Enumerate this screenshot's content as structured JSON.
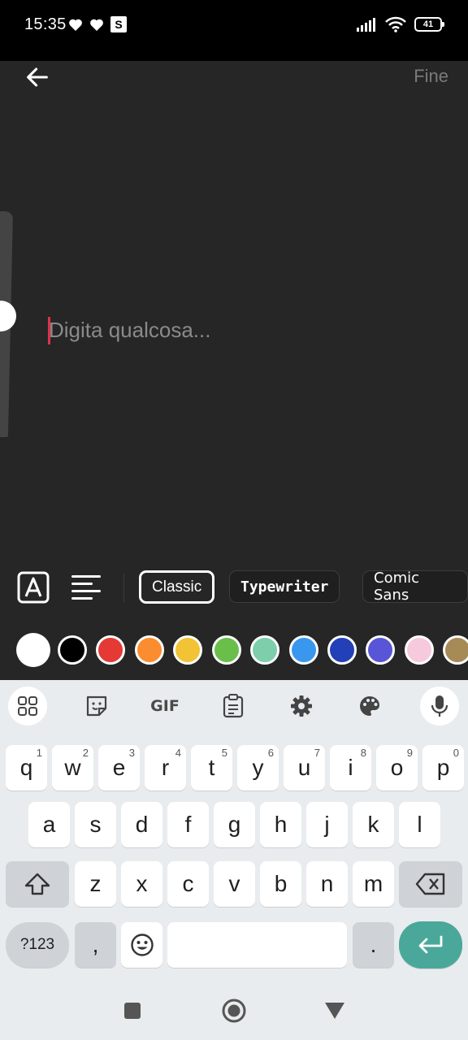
{
  "status_bar": {
    "time": "15:35",
    "battery": "41",
    "badge": "S"
  },
  "editor": {
    "done_label": "Fine",
    "placeholder": "Digita qualcosa..."
  },
  "fonts": [
    {
      "label": "Classic",
      "selected": true
    },
    {
      "label": "Typewriter",
      "selected": false
    },
    {
      "label": "Comic Sans",
      "selected": false
    }
  ],
  "colors": [
    "#ffffff",
    "#000000",
    "#e53935",
    "#fb8c2f",
    "#f2c335",
    "#6abf4b",
    "#7ccfaa",
    "#3a97ee",
    "#2340b8",
    "#5856d6",
    "#f6c9dd",
    "#a68b57"
  ],
  "keyboard": {
    "top_icons": [
      "apps-grid-icon",
      "sticker-icon",
      "GIF",
      "clipboard-icon",
      "gear-icon",
      "palette-icon",
      "mic-icon"
    ],
    "gif_label": "GIF",
    "row1": [
      "q",
      "w",
      "e",
      "r",
      "t",
      "y",
      "u",
      "i",
      "o",
      "p"
    ],
    "row1_hints": [
      "1",
      "2",
      "3",
      "4",
      "5",
      "6",
      "7",
      "8",
      "9",
      "0"
    ],
    "row2": [
      "a",
      "s",
      "d",
      "f",
      "g",
      "h",
      "j",
      "k",
      "l"
    ],
    "row3": [
      "z",
      "x",
      "c",
      "v",
      "b",
      "n",
      "m"
    ],
    "symbols_label": "?123",
    "comma": ",",
    "period": "."
  }
}
